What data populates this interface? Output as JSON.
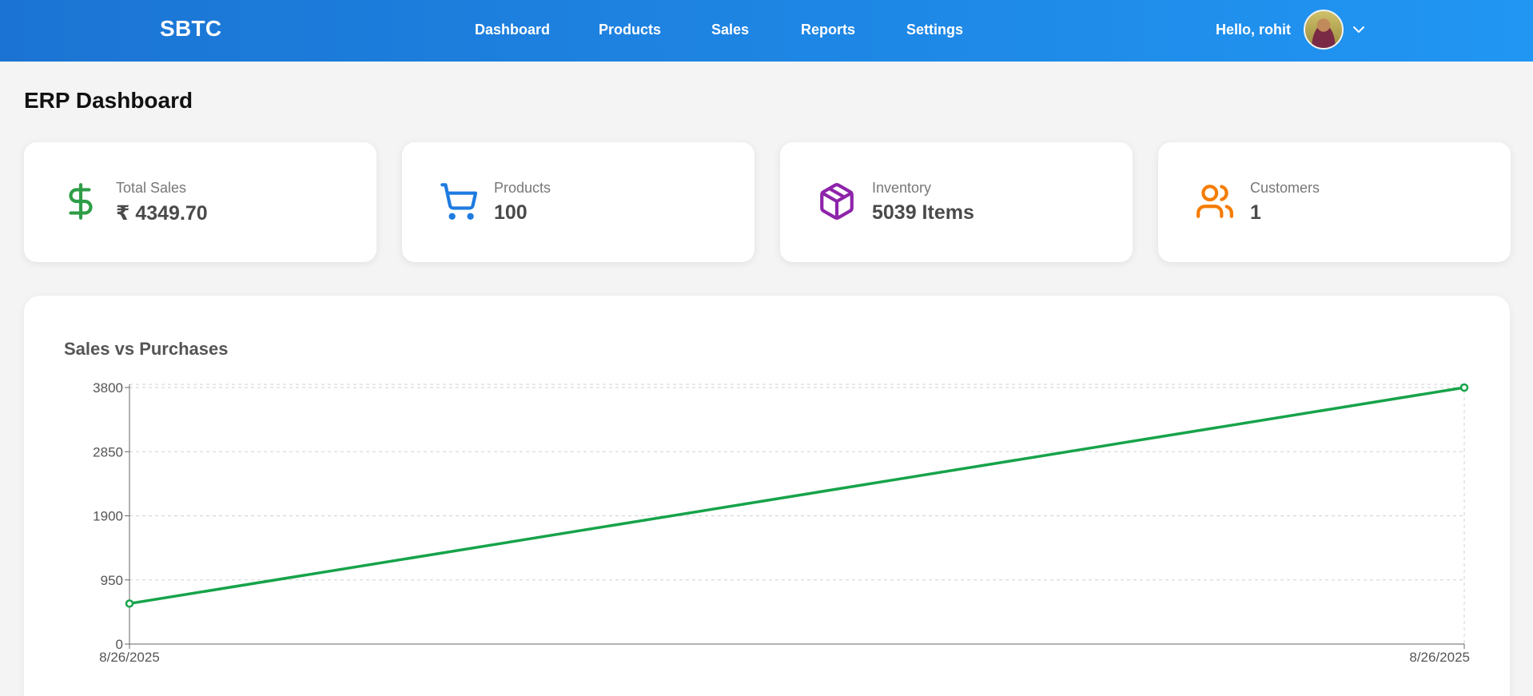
{
  "nav": {
    "brand": "SBTC",
    "links": [
      "Dashboard",
      "Products",
      "Sales",
      "Reports",
      "Settings"
    ],
    "greeting": "Hello, rohit"
  },
  "page": {
    "title": "ERP Dashboard"
  },
  "cards": [
    {
      "label": "Total Sales",
      "value": "₹ 4349.70",
      "icon": "dollar-icon",
      "color": "#2e9d47"
    },
    {
      "label": "Products",
      "value": "100",
      "icon": "cart-icon",
      "color": "#1e7be0"
    },
    {
      "label": "Inventory",
      "value": "5039 Items",
      "icon": "box-icon",
      "color": "#8e24aa"
    },
    {
      "label": "Customers",
      "value": "1",
      "icon": "users-icon",
      "color": "#f57c00"
    }
  ],
  "chart_data": {
    "type": "line",
    "title": "Sales vs Purchases",
    "x": [
      "8/26/2025",
      "8/26/2025"
    ],
    "series": [
      {
        "values": [
          600,
          3800
        ],
        "color": "#16a34a"
      }
    ],
    "yticks": [
      0,
      950,
      1900,
      2850,
      3800
    ],
    "ylim": [
      0,
      3800
    ],
    "grid": true
  }
}
